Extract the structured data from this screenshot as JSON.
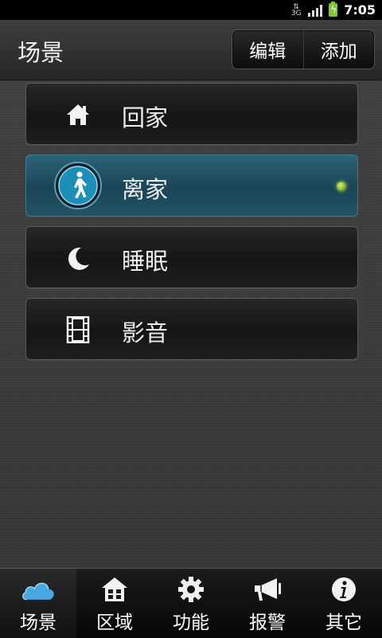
{
  "status_bar": {
    "network": "3G",
    "clock": "7:05",
    "signal_icon": "signal-icon",
    "battery_icon": "battery-charging-icon"
  },
  "header": {
    "title": "场景",
    "edit_label": "编辑",
    "add_label": "添加"
  },
  "scenes": [
    {
      "label": "回家",
      "icon": "home-icon",
      "active": false
    },
    {
      "label": "离家",
      "icon": "walking-person-icon",
      "active": true
    },
    {
      "label": "睡眠",
      "icon": "moon-icon",
      "active": false
    },
    {
      "label": "影音",
      "icon": "film-icon",
      "active": false
    }
  ],
  "tabs": [
    {
      "label": "场景",
      "icon": "cloud-icon",
      "active": true
    },
    {
      "label": "区域",
      "icon": "house-icon",
      "active": false
    },
    {
      "label": "功能",
      "icon": "gear-icon",
      "active": false
    },
    {
      "label": "报警",
      "icon": "megaphone-icon",
      "active": false
    },
    {
      "label": "其它",
      "icon": "info-icon",
      "active": false
    }
  ],
  "colors": {
    "accent": "#2d6478",
    "indicator": "#a8d64a",
    "battery": "#7fc630"
  }
}
